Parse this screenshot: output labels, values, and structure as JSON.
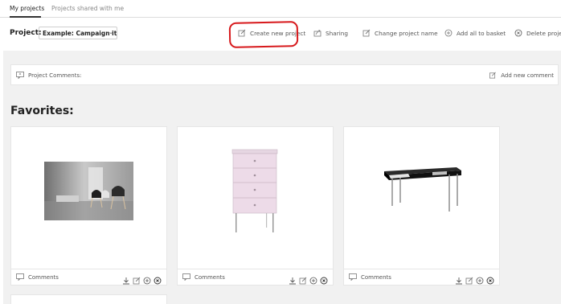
{
  "tabs": [
    {
      "label": "My projects",
      "active": true
    },
    {
      "label": "Projects shared with me",
      "active": false
    }
  ],
  "toolbar": {
    "project_label": "Project:",
    "project_select_value": "Example: Campaign it...",
    "actions": [
      {
        "label": "Create new project",
        "icon": "edit-icon"
      },
      {
        "label": "Sharing",
        "icon": "share-icon"
      },
      {
        "label": "Change project name",
        "icon": "edit-icon"
      },
      {
        "label": "Add all to basket",
        "icon": "plus-circle-icon"
      },
      {
        "label": "Delete project",
        "icon": "x-circle-icon"
      }
    ]
  },
  "project_comments": {
    "label": "Project Comments:",
    "add_label": "Add new comment"
  },
  "favorites": {
    "title": "Favorites:",
    "items": [
      {
        "image": "room-chairs-photo",
        "comments_label": "Comments"
      },
      {
        "image": "pink-drawer-cabinet",
        "comments_label": "Comments"
      },
      {
        "image": "black-desk",
        "comments_label": "Comments"
      }
    ]
  },
  "colors": {
    "highlight": "#d7191c",
    "content_bg": "#f1f1f1"
  }
}
